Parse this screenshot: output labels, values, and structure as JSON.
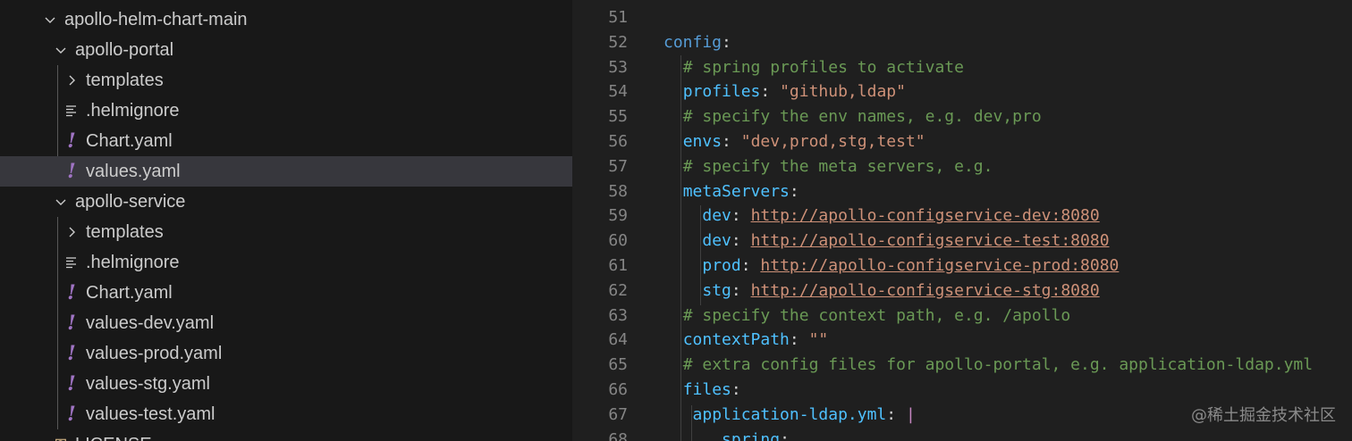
{
  "explorer": {
    "items": [
      {
        "label": "apollo-helm-chart-main",
        "kind": "folder-open"
      },
      {
        "label": "apollo-portal",
        "kind": "folder-open"
      },
      {
        "label": "templates",
        "kind": "folder-closed"
      },
      {
        "label": ".helmignore",
        "kind": "text-file"
      },
      {
        "label": "Chart.yaml",
        "kind": "yaml-file"
      },
      {
        "label": "values.yaml",
        "kind": "yaml-file",
        "selected": true
      },
      {
        "label": "apollo-service",
        "kind": "folder-open"
      },
      {
        "label": "templates",
        "kind": "folder-closed"
      },
      {
        "label": ".helmignore",
        "kind": "text-file"
      },
      {
        "label": "Chart.yaml",
        "kind": "yaml-file"
      },
      {
        "label": "values-dev.yaml",
        "kind": "yaml-file"
      },
      {
        "label": "values-prod.yaml",
        "kind": "yaml-file"
      },
      {
        "label": "values-stg.yaml",
        "kind": "yaml-file"
      },
      {
        "label": "values-test.yaml",
        "kind": "yaml-file"
      },
      {
        "label": "LICENSE",
        "kind": "license-file"
      }
    ],
    "yaml_icon_glyph": "!"
  },
  "editor": {
    "lines": [
      {
        "n": "51",
        "tokens": []
      },
      {
        "n": "52",
        "tokens": [
          {
            "t": "config",
            "c": "k2"
          },
          {
            "t": ":",
            "c": "p"
          }
        ]
      },
      {
        "n": "53",
        "tokens": [
          {
            "t": "  ",
            "c": "p"
          },
          {
            "t": "# spring profiles to activate",
            "c": "c"
          }
        ]
      },
      {
        "n": "54",
        "tokens": [
          {
            "t": "  ",
            "c": "p"
          },
          {
            "t": "profiles",
            "c": "k"
          },
          {
            "t": ": ",
            "c": "p"
          },
          {
            "t": "\"github,ldap\"",
            "c": "s"
          }
        ]
      },
      {
        "n": "55",
        "tokens": [
          {
            "t": "  ",
            "c": "p"
          },
          {
            "t": "# specify the env names, e.g. dev,pro",
            "c": "c"
          }
        ]
      },
      {
        "n": "56",
        "tokens": [
          {
            "t": "  ",
            "c": "p"
          },
          {
            "t": "envs",
            "c": "k"
          },
          {
            "t": ": ",
            "c": "p"
          },
          {
            "t": "\"dev,prod,stg,test\"",
            "c": "s"
          }
        ]
      },
      {
        "n": "57",
        "tokens": [
          {
            "t": "  ",
            "c": "p"
          },
          {
            "t": "# specify the meta servers, e.g.",
            "c": "c"
          }
        ]
      },
      {
        "n": "58",
        "tokens": [
          {
            "t": "  ",
            "c": "p"
          },
          {
            "t": "metaServers",
            "c": "k"
          },
          {
            "t": ":",
            "c": "p"
          }
        ]
      },
      {
        "n": "59",
        "tokens": [
          {
            "t": "    ",
            "c": "p"
          },
          {
            "t": "dev",
            "c": "k"
          },
          {
            "t": ": ",
            "c": "p"
          },
          {
            "t": "http://apollo-configservice-dev:8080",
            "c": "u"
          }
        ]
      },
      {
        "n": "60",
        "tokens": [
          {
            "t": "    ",
            "c": "p"
          },
          {
            "t": "dev",
            "c": "k"
          },
          {
            "t": ": ",
            "c": "p"
          },
          {
            "t": "http://apollo-configservice-test:8080",
            "c": "u"
          }
        ]
      },
      {
        "n": "61",
        "tokens": [
          {
            "t": "    ",
            "c": "p"
          },
          {
            "t": "prod",
            "c": "k"
          },
          {
            "t": ": ",
            "c": "p"
          },
          {
            "t": "http://apollo-configservice-prod:8080",
            "c": "u"
          }
        ]
      },
      {
        "n": "62",
        "tokens": [
          {
            "t": "    ",
            "c": "p"
          },
          {
            "t": "stg",
            "c": "k"
          },
          {
            "t": ": ",
            "c": "p"
          },
          {
            "t": "http://apollo-configservice-stg:8080",
            "c": "u"
          }
        ]
      },
      {
        "n": "63",
        "tokens": [
          {
            "t": "  ",
            "c": "p"
          },
          {
            "t": "# specify the context path, e.g. /apollo",
            "c": "c"
          }
        ]
      },
      {
        "n": "64",
        "tokens": [
          {
            "t": "  ",
            "c": "p"
          },
          {
            "t": "contextPath",
            "c": "k"
          },
          {
            "t": ": ",
            "c": "p"
          },
          {
            "t": "\"\"",
            "c": "s"
          }
        ]
      },
      {
        "n": "65",
        "tokens": [
          {
            "t": "  ",
            "c": "p"
          },
          {
            "t": "# extra config files for apollo-portal, e.g. application-ldap.yml",
            "c": "c"
          }
        ]
      },
      {
        "n": "66",
        "tokens": [
          {
            "t": "  ",
            "c": "p"
          },
          {
            "t": "files",
            "c": "k"
          },
          {
            "t": ":",
            "c": "p"
          }
        ]
      },
      {
        "n": "67",
        "tokens": [
          {
            "t": "   ",
            "c": "p"
          },
          {
            "t": "application-ldap.yml",
            "c": "k"
          },
          {
            "t": ": ",
            "c": "p"
          },
          {
            "t": "|",
            "c": "caret"
          }
        ]
      },
      {
        "n": "68",
        "tokens": [
          {
            "t": "      ",
            "c": "p"
          },
          {
            "t": "spring",
            "c": "k"
          },
          {
            "t": ":",
            "c": "p"
          }
        ]
      }
    ]
  },
  "watermark": "@稀土掘金技术社区",
  "colors": {
    "keyword": "#4fc1ff",
    "comment": "#6a9955",
    "string": "#ce9178",
    "yaml_icon": "#a074c4",
    "selection": "#37373d"
  }
}
